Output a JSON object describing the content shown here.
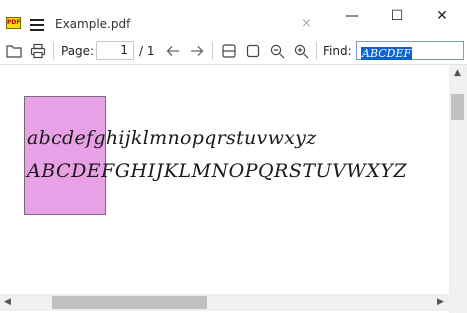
{
  "window": {
    "tab_title": "Example.pdf",
    "app_icon_text": "PDF",
    "tab_close": "×",
    "minimize": "—",
    "maximize": "☐",
    "close": "✕"
  },
  "toolbar": {
    "page_label": "Page:",
    "page_value": "1",
    "page_total": "/ 1",
    "find_label": "Find:",
    "find_value": "ABCDEF"
  },
  "document": {
    "line1": "abcdefghijklmnopqrstuvwxyz",
    "line2": "ABCDEFGHIJKLMNOPQRSTUVWXYZ"
  },
  "colors": {
    "highlight": "#e8a1e6",
    "find_selection": "#0a64d0"
  },
  "icons": [
    "pdf-app-icon",
    "menu-icon",
    "open-folder-icon",
    "print-icon",
    "arrow-left-icon",
    "arrow-right-icon",
    "fit-width-icon",
    "fit-page-icon",
    "zoom-out-icon",
    "zoom-in-icon"
  ]
}
